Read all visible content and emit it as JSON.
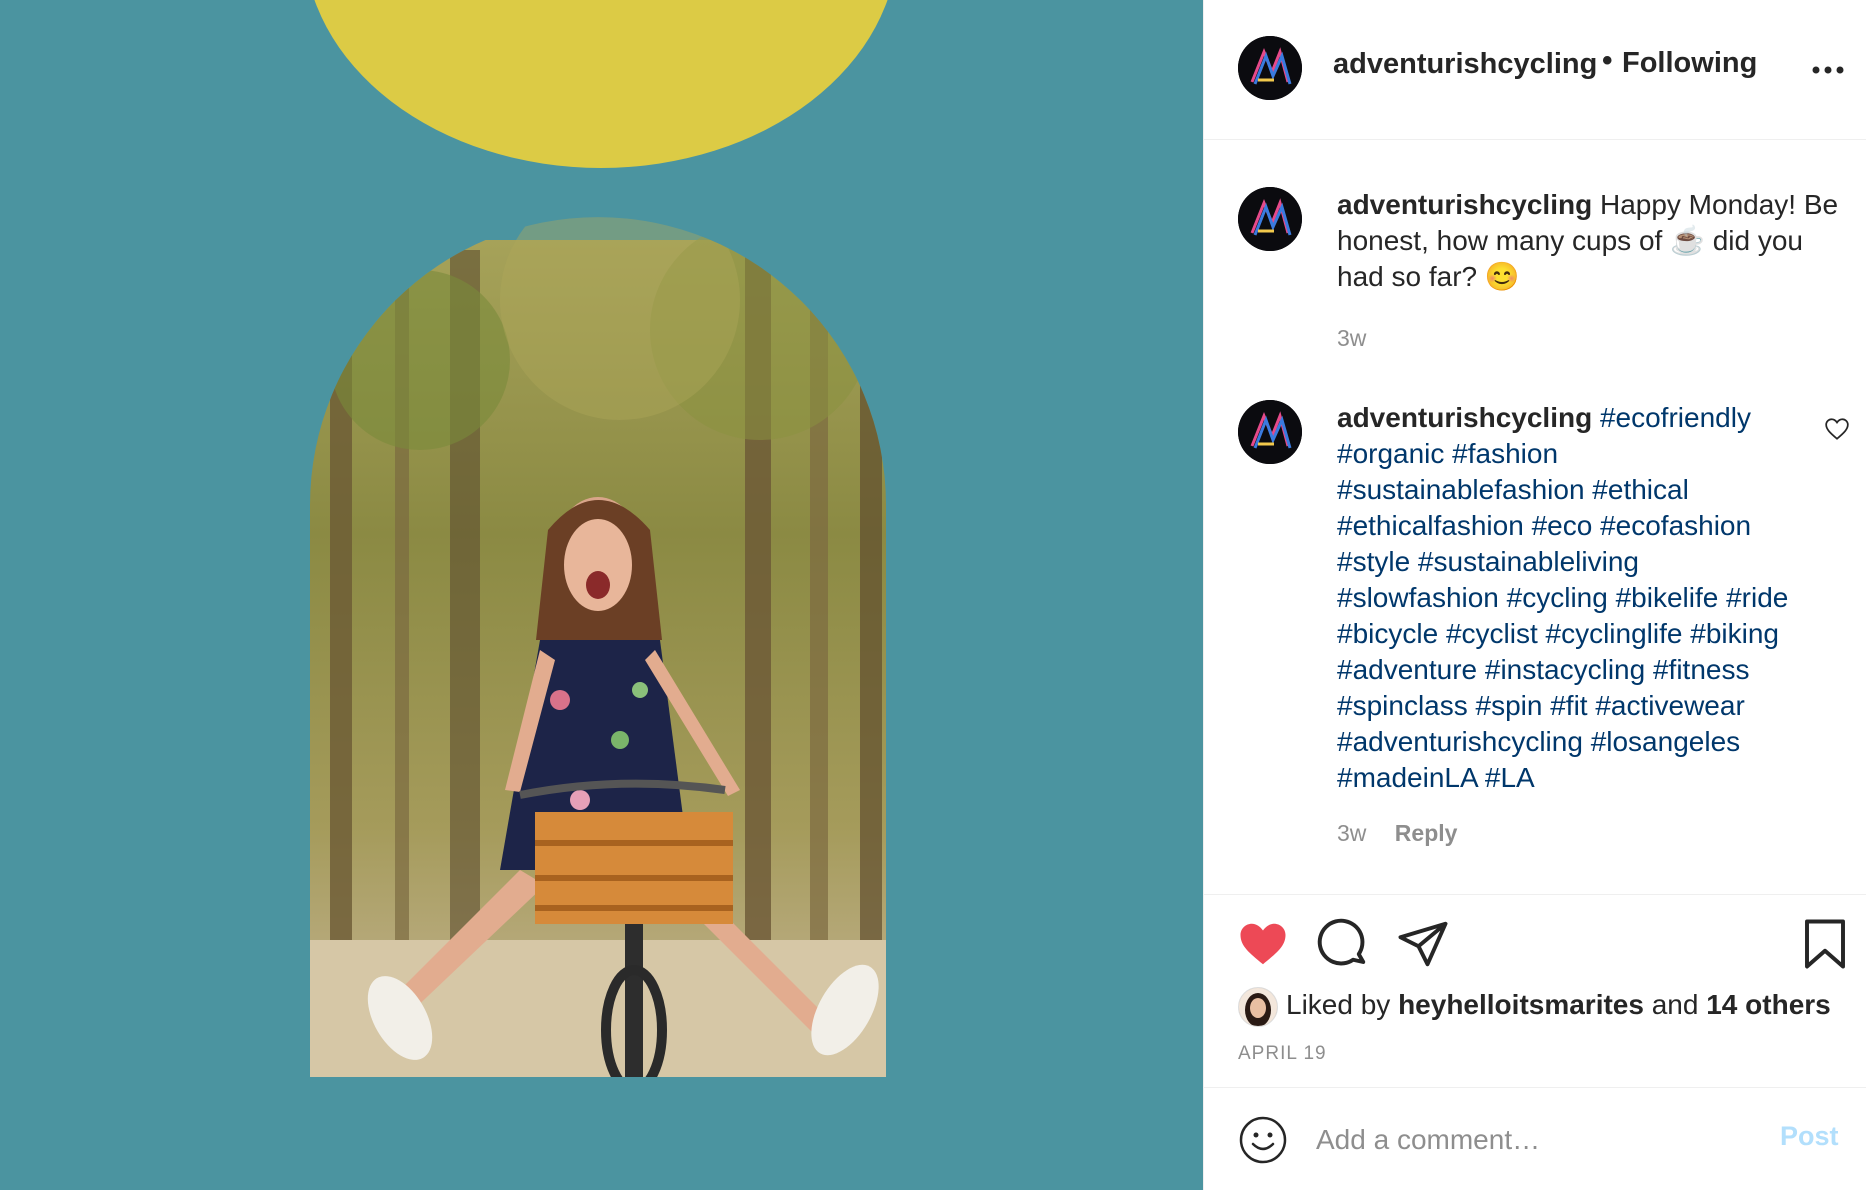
{
  "post": {
    "colors": {
      "background": "#4b94a0",
      "sun": "#dccb45",
      "accent_like": "#ed4956",
      "hashtag": "#00376b"
    }
  },
  "header": {
    "username": "adventurishcycling",
    "separator": "•",
    "follow_status": "Following",
    "more_icon": "more-horizontal-icon"
  },
  "caption": {
    "username": "adventurishcycling",
    "text": "Happy Monday! Be honest, how many cups of ☕ did you had so far? 😊",
    "time": "3w"
  },
  "comment": {
    "username": "adventurishcycling",
    "hashtags": "#ecofriendly #organic #fashion #sustainablefashion #ethical #ethicalfashion #eco #ecofashion #style #sustainableliving #slowfashion #cycling #bikelife #ride #bicycle #cyclist #cyclinglife #biking #adventure #instacycling #fitness #spinclass #spin #fit #activewear #adventurishcycling #losangeles #madeinLA #LA",
    "time": "3w",
    "reply_label": "Reply"
  },
  "actions": {
    "like_icon": "heart-filled-icon",
    "comment_icon": "comment-icon",
    "share_icon": "share-icon",
    "save_icon": "bookmark-icon"
  },
  "likes": {
    "prefix": "Liked by",
    "liker": "heyhelloitsmarites",
    "middle": "and",
    "others": "14 others"
  },
  "date": "APRIL 19",
  "comment_box": {
    "placeholder": "Add a comment…",
    "post_label": "Post"
  }
}
